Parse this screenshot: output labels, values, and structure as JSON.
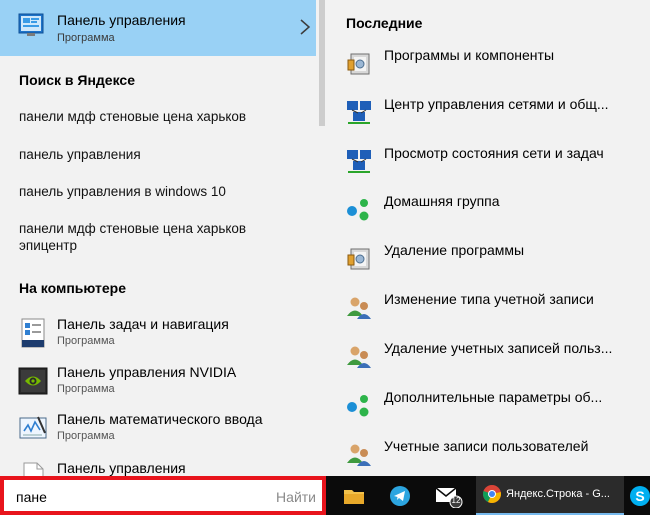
{
  "best_match": {
    "title": "Панель управления",
    "subtitle": "Программа"
  },
  "web_section": {
    "heading": "Поиск в Яндексе",
    "suggestions": [
      "панели мдф стеновые цена харьков",
      "панель управления",
      "панель управления в windows 10",
      "панели мдф стеновые цена харьков\nэпицентр"
    ]
  },
  "pc_section": {
    "heading": "На компьютере",
    "items": [
      {
        "title": "Панель задач и навигация",
        "subtitle": "Программа",
        "icon": "taskbar-settings-icon"
      },
      {
        "title": "Панель управления NVIDIA",
        "subtitle": "Программа",
        "icon": "nvidia-icon"
      },
      {
        "title": "Панель математического ввода",
        "subtitle": "Программа",
        "icon": "math-input-icon"
      },
      {
        "title": "Панель управления",
        "subtitle": "",
        "icon": "document-icon"
      }
    ]
  },
  "recent": {
    "heading": "Последние",
    "items": [
      {
        "label": "Программы и компоненты",
        "icon": "programs-features-icon"
      },
      {
        "label": "Центр управления сетями и общ...",
        "icon": "network-center-icon"
      },
      {
        "label": "Просмотр состояния сети и задач",
        "icon": "network-status-icon"
      },
      {
        "label": "Домашняя группа",
        "icon": "homegroup-icon"
      },
      {
        "label": "Удаление программы",
        "icon": "uninstall-icon"
      },
      {
        "label": "Изменение типа учетной записи",
        "icon": "user-accounts-icon"
      },
      {
        "label": "Удаление учетных записей польз...",
        "icon": "user-accounts-icon"
      },
      {
        "label": "Дополнительные параметры об...",
        "icon": "homegroup-icon"
      },
      {
        "label": "Учетные записи пользователей",
        "icon": "user-accounts-icon"
      }
    ]
  },
  "search": {
    "value": "пане",
    "button": "Найти"
  },
  "taskbar": {
    "mail_badge": "12",
    "yandex_label": "Яндекс.Строка - G..."
  },
  "colors": {
    "highlight": "#99d1f5",
    "search_border": "#e8141c",
    "panel_bg": "#f2f2f2",
    "taskbar_bg": "#0b0b0b"
  }
}
